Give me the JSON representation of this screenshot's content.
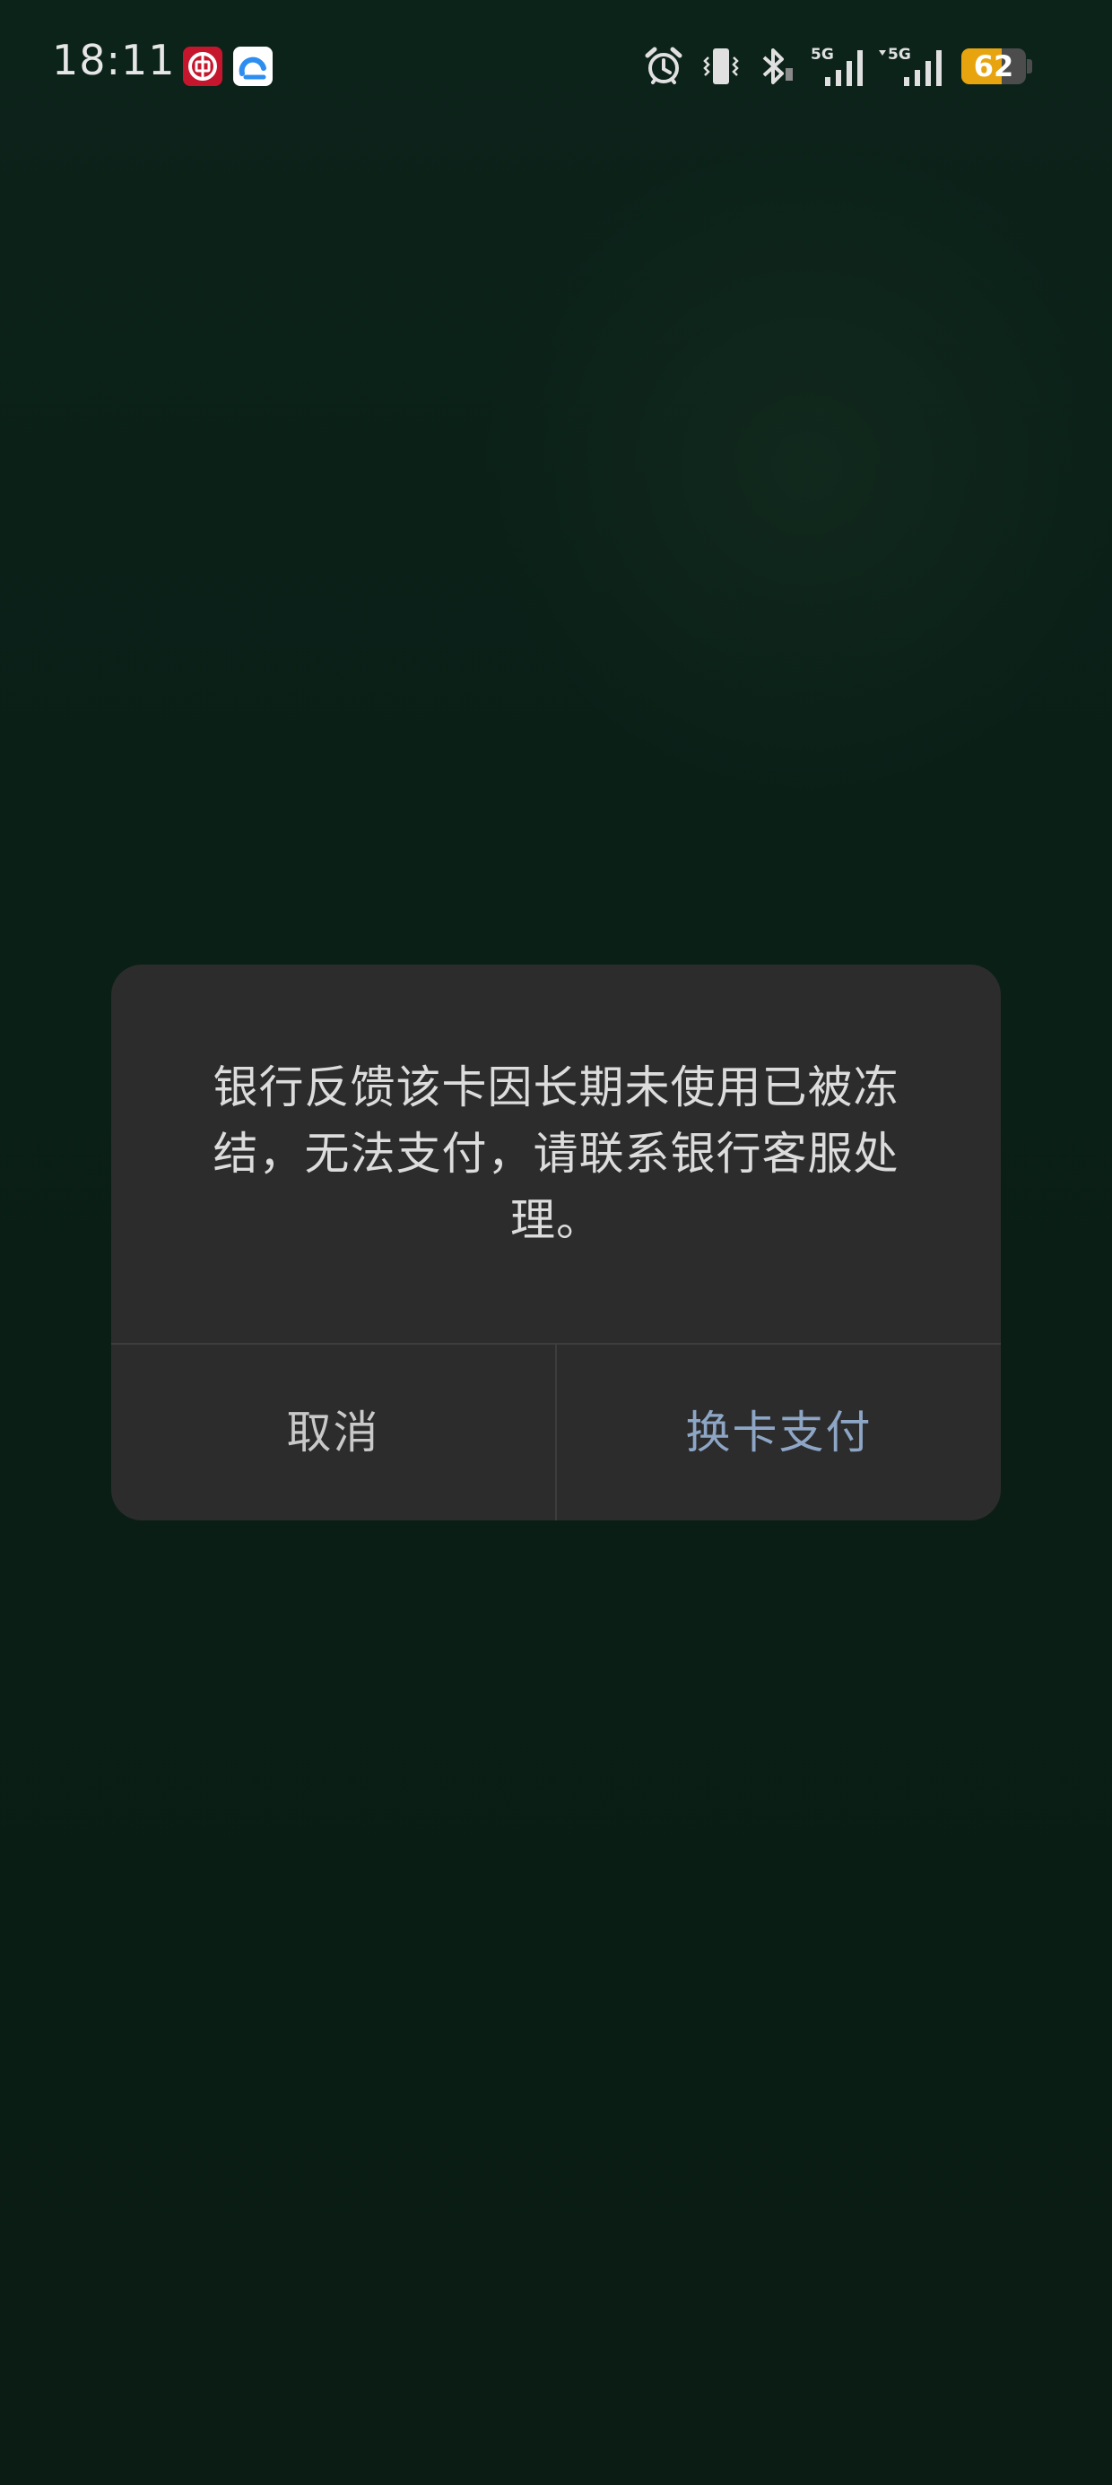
{
  "status_bar": {
    "time": "18:11",
    "notifications": [
      "bank-of-china-icon",
      "cloud-app-icon"
    ],
    "system_icons": [
      "alarm-icon",
      "vibrate-icon",
      "bluetooth-icon",
      "signal-5g-icon",
      "signal-5g-icon"
    ],
    "signal_labels": [
      "5G",
      "5G"
    ],
    "battery_level": 62,
    "battery_text": "62",
    "battery_color": "#e7a40e"
  },
  "dialog": {
    "message": "银行反馈该卡因长期未使用已被冻结，无法支付，请联系银行客服处理。",
    "cancel_label": "取消",
    "switch_card_label": "换卡支付",
    "accent_color": "#8ea6c6"
  },
  "background_color": "#0a1c14"
}
